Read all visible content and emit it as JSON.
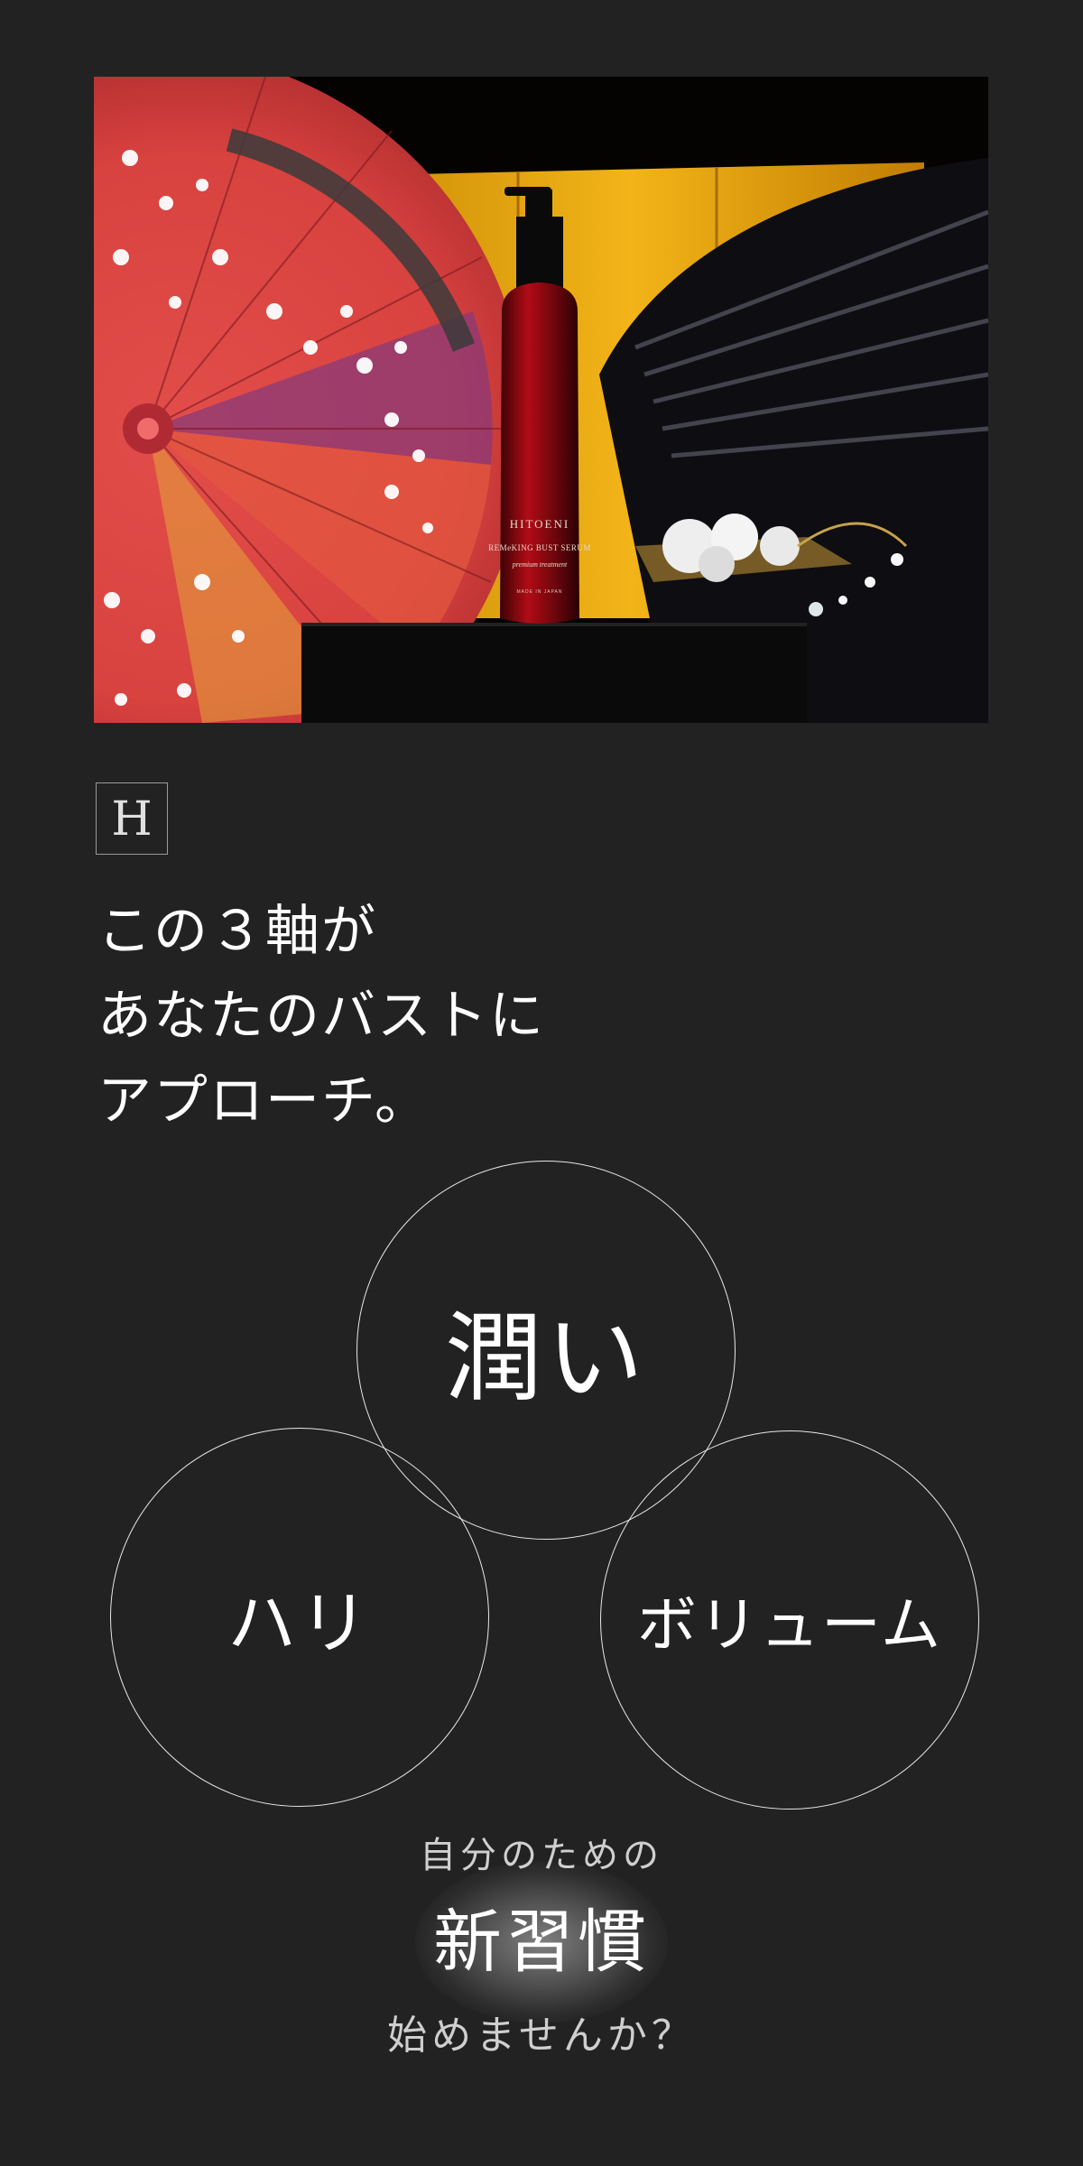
{
  "hero": {
    "brand": "HITOENI",
    "product_line": "REMeKING BUST SERUM",
    "product_script": "premium treatment",
    "origin": "MADE IN JAPAN"
  },
  "logo": {
    "letter": "H"
  },
  "heading": {
    "lines": [
      "この３軸が",
      "あなたのバストに",
      "アプローチ。"
    ]
  },
  "axes": {
    "top": "潤い",
    "left": "ハリ",
    "right": "ボリューム"
  },
  "closing": {
    "sub": "自分のための",
    "main": "新習慣",
    "end": "始めませんか？"
  },
  "colors": {
    "background": "#222222",
    "text": "#ffffff",
    "muted_text": "#cfcfcf",
    "circle_stroke": "#e8e8e8"
  }
}
